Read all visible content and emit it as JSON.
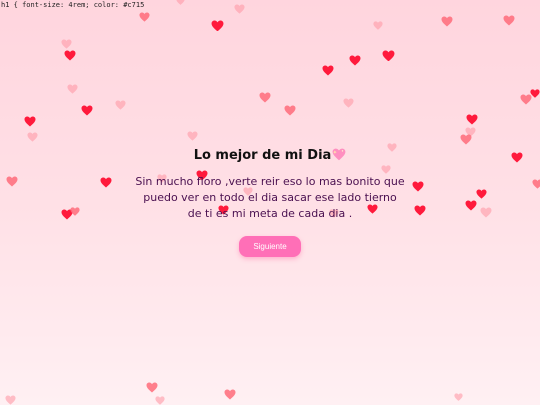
{
  "css_leak_text": "h1 { font-size: 4rem; color: #c715",
  "card": {
    "title": "Lo mejor de mi Dia",
    "title_emoji": "sparkling-heart-icon",
    "message": "Sin mucho floro ,verte reir eso lo mas bonito que puedo ver en todo el dia sacar ese lado tierno de ti es mi meta de cada dia .",
    "button_label": "Siguiente"
  },
  "colors": {
    "heart_red": "#ff1a3c",
    "heart_pink": "#ff6b7a",
    "heart_light": "#ff9aa6",
    "button": "#ff6fb7",
    "message_text": "#4a1050"
  }
}
